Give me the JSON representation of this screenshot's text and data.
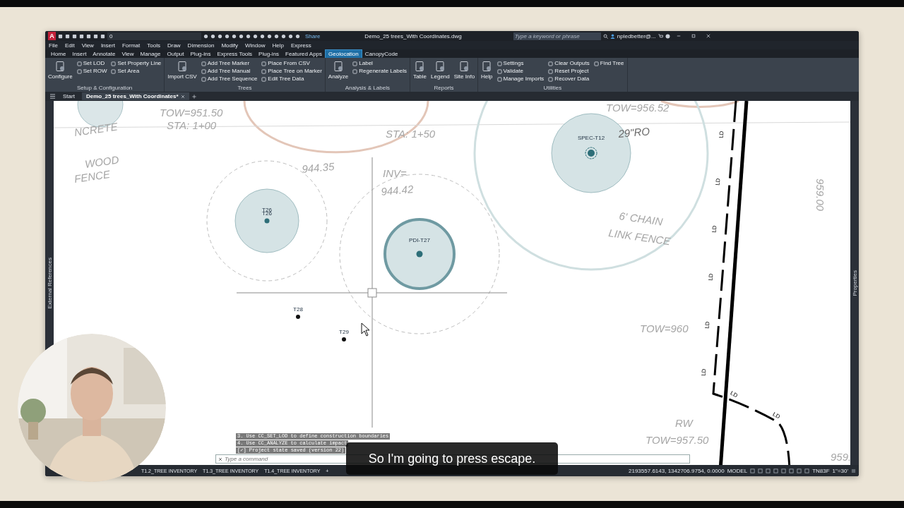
{
  "app": {
    "letter": "A",
    "layer": "0",
    "share": "Share"
  },
  "window": {
    "title": "Demo_25 trees_With Coordinates.dwg",
    "search_placeholder": "Type a keyword or phrase",
    "user": "npledbetter@..."
  },
  "menu": [
    "File",
    "Edit",
    "View",
    "Insert",
    "Format",
    "Tools",
    "Draw",
    "Dimension",
    "Modify",
    "Window",
    "Help",
    "Express"
  ],
  "ribbon_tabs": [
    {
      "label": "Home",
      "selected": false
    },
    {
      "label": "Insert",
      "selected": false
    },
    {
      "label": "Annotate",
      "selected": false
    },
    {
      "label": "View",
      "selected": false
    },
    {
      "label": "Manage",
      "selected": false
    },
    {
      "label": "Output",
      "selected": false
    },
    {
      "label": "Plug-ins",
      "selected": false
    },
    {
      "label": "Express Tools",
      "selected": false
    },
    {
      "label": "Plug-ins",
      "selected": false
    },
    {
      "label": "Featured Apps",
      "selected": false
    },
    {
      "label": "Geolocation",
      "selected": true
    },
    {
      "label": "CanopyCode",
      "selected": false
    }
  ],
  "ribbon_groups": [
    {
      "title": "Setup & Configuration",
      "large": [
        "Configure"
      ],
      "columns": [
        [
          "Set LOD",
          "Set ROW"
        ],
        [
          "Set Property Line",
          "Set Area"
        ]
      ]
    },
    {
      "title": "Trees",
      "large": [
        "Import CSV"
      ],
      "columns": [
        [
          "Add Tree Marker",
          "Add Tree Manual",
          "Add Tree Sequence"
        ],
        [
          "Place From CSV",
          "Place Tree on Marker",
          "Edit Tree Data"
        ]
      ]
    },
    {
      "title": "Analysis & Labels",
      "large": [
        "Analyze"
      ],
      "columns": [
        [
          "Label",
          "Regenerate Labels"
        ]
      ]
    },
    {
      "title": "Reports",
      "large": [
        "Table",
        "Legend",
        "Site Info"
      ]
    },
    {
      "title": "Utilities",
      "large": [
        "Help"
      ],
      "columns": [
        [
          "Settings",
          "Validate",
          "Manage Imports"
        ],
        [
          "Clear Outputs",
          "Reset Project",
          "Recover Data"
        ],
        [
          "Find Tree"
        ]
      ]
    }
  ],
  "doc_tabs": [
    {
      "label": "Start",
      "selected": false
    },
    {
      "label": "Demo_25 trees_With Coordinates*",
      "selected": true
    }
  ],
  "side_panels": {
    "left": "External References",
    "right": "Properties"
  },
  "drawing": {
    "trees": [
      {
        "kind": "canopy",
        "labels": [
          "T26",
          "T26"
        ]
      },
      {
        "kind": "highlighted",
        "labels": [
          "PDI-T27"
        ]
      },
      {
        "kind": "specimen",
        "labels": [
          "SPEC-T12"
        ]
      },
      {
        "kind": "point",
        "labels": [
          "T28"
        ]
      },
      {
        "kind": "point",
        "labels": [
          "T29"
        ]
      }
    ],
    "annotations": [
      "TOW=951.50",
      "STA: 1+00",
      "NCRETE",
      "WOOD",
      "FENCE",
      "STA: 1+50",
      "TOW=956.52",
      "29\"RO",
      "INV=",
      "944.42",
      "944.35",
      "6' CHAIN",
      "LINK FENCE",
      "TOW=960",
      "RW",
      "TOW=957.50",
      "959.",
      "959.00"
    ],
    "line_labels": [
      "LD",
      "LD",
      "LD",
      "LD",
      "LD",
      "LD",
      "LD",
      "LD"
    ]
  },
  "command_line": {
    "history": [
      "3. Use CC_SET_LOD to define construction boundaries",
      "4. Use CC_ANALYZE to calculate impact",
      "[✓] Project state saved (version 22)"
    ],
    "placeholder": "Type a command"
  },
  "layout_tabs": [
    "T1.2_TREE INVENTORY",
    "T1.3_TREE INVENTORY",
    "T1.4_TREE INVENTORY",
    "+"
  ],
  "status": {
    "coordinates": "2193557.6143, 1342706.9754, 0.0000",
    "space": "MODEL",
    "units": "TN83F",
    "scale": "1\"=30'"
  },
  "caption": "So I'm going to press escape."
}
